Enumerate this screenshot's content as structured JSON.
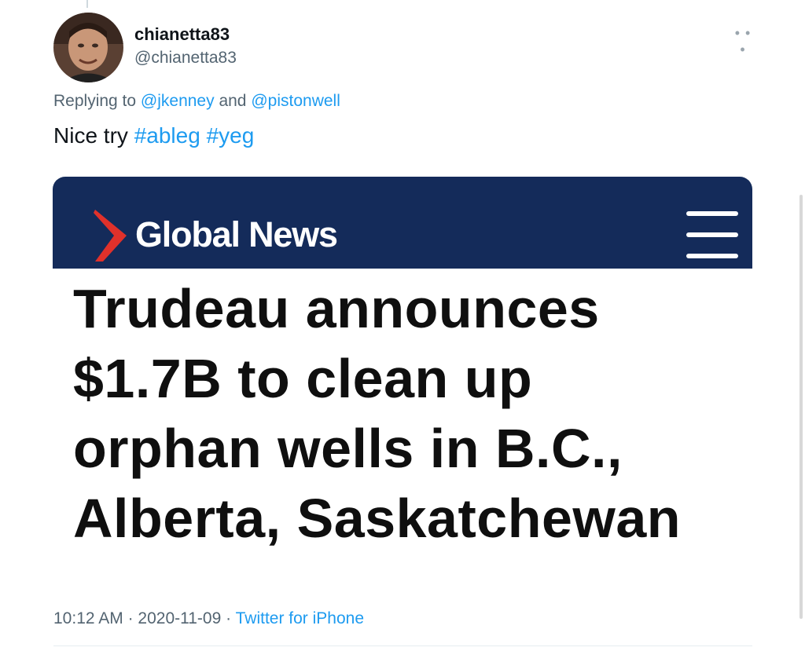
{
  "tweet": {
    "author": {
      "display_name": "chianetta83",
      "handle": "@chianetta83",
      "avatar_icon": "profile-photo"
    },
    "more_icon": "more-options-icon",
    "reply": {
      "prefix": "Replying to",
      "mention_1": "@jkenney",
      "joiner": "and",
      "mention_2": "@pistonwell"
    },
    "text": {
      "body": "Nice try",
      "hashtag_1": "#ableg",
      "hashtag_2": "#yeg"
    },
    "media": {
      "brand": "Global News",
      "menu_icon": "hamburger-menu-icon",
      "headline": "Trudeau announces\n$1.7B to clean up\norphan wells in B.C.,\nAlberta, Saskatchewan"
    },
    "meta": {
      "time": "10:12 AM",
      "date": "2020-11-09",
      "separator": "·",
      "source": "Twitter for iPhone"
    },
    "colors": {
      "link": "#1d9bf0",
      "secondary_text": "#536471",
      "brand_navy": "#142b5a",
      "brand_red": "#e0312b"
    }
  }
}
